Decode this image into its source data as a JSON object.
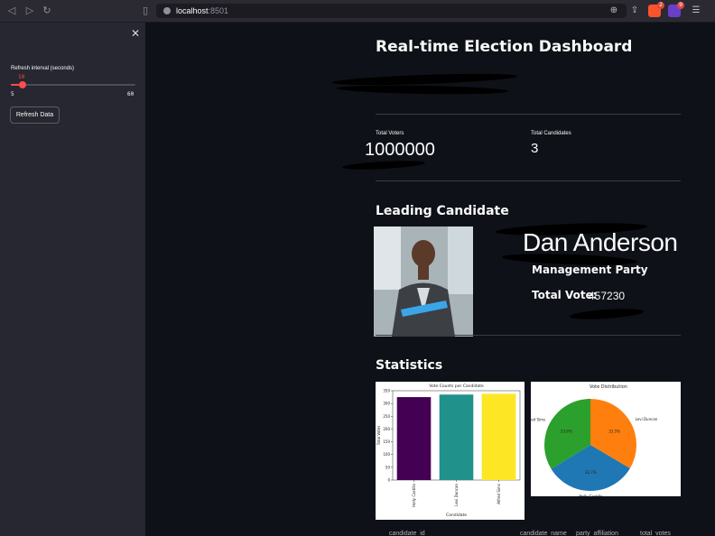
{
  "browser": {
    "url_host": "localhost",
    "url_port": ":8501",
    "extension_badges": [
      "2",
      "9"
    ]
  },
  "sidebar": {
    "slider": {
      "label": "Refresh interval (seconds)",
      "value": 10,
      "min": 5,
      "max": 60
    },
    "refresh_button_label": "Refresh Data"
  },
  "main": {
    "title": "Real-time Election Dashboard",
    "metrics": [
      {
        "label": "Total Voters",
        "value": "1000000"
      },
      {
        "label": "Total Candidates",
        "value": "3"
      }
    ],
    "leading": {
      "section_title": "Leading Candidate",
      "name": "Dan Anderson",
      "party": "Management Party",
      "vote_label": "Total Vote:",
      "vote_value": "457230"
    },
    "statistics_title": "Statistics",
    "table_headers": [
      "candidate_id",
      "candidate_name",
      "party_affiliation",
      "total_votes"
    ]
  },
  "colors": {
    "background": "#0e1117",
    "sidebar": "#262730",
    "accent": "#ff4b4b"
  },
  "chart_data": [
    {
      "type": "bar",
      "title": "Vote Counts per Candidate",
      "xlabel": "Candidate",
      "ylabel": "Total Votes",
      "categories": [
        "Holly Castillo",
        "Levi Duncan",
        "Alfred Sims"
      ],
      "values": [
        325,
        335,
        338
      ],
      "colors": [
        "#440154",
        "#21918c",
        "#fde725"
      ],
      "ylim": [
        0,
        350
      ],
      "yticks": [
        0,
        50,
        100,
        150,
        200,
        250,
        300,
        350
      ]
    },
    {
      "type": "pie",
      "title": "Vote Distribution",
      "labels": [
        "Alfred Sims",
        "Holly Castillo",
        "Levi Duncan"
      ],
      "values": [
        33.8,
        32.7,
        33.5
      ],
      "percent_labels": [
        "33.8%",
        "32.7%",
        "33.5%"
      ],
      "colors": [
        "#2ca02c",
        "#1f77b4",
        "#ff7f0e"
      ]
    }
  ]
}
